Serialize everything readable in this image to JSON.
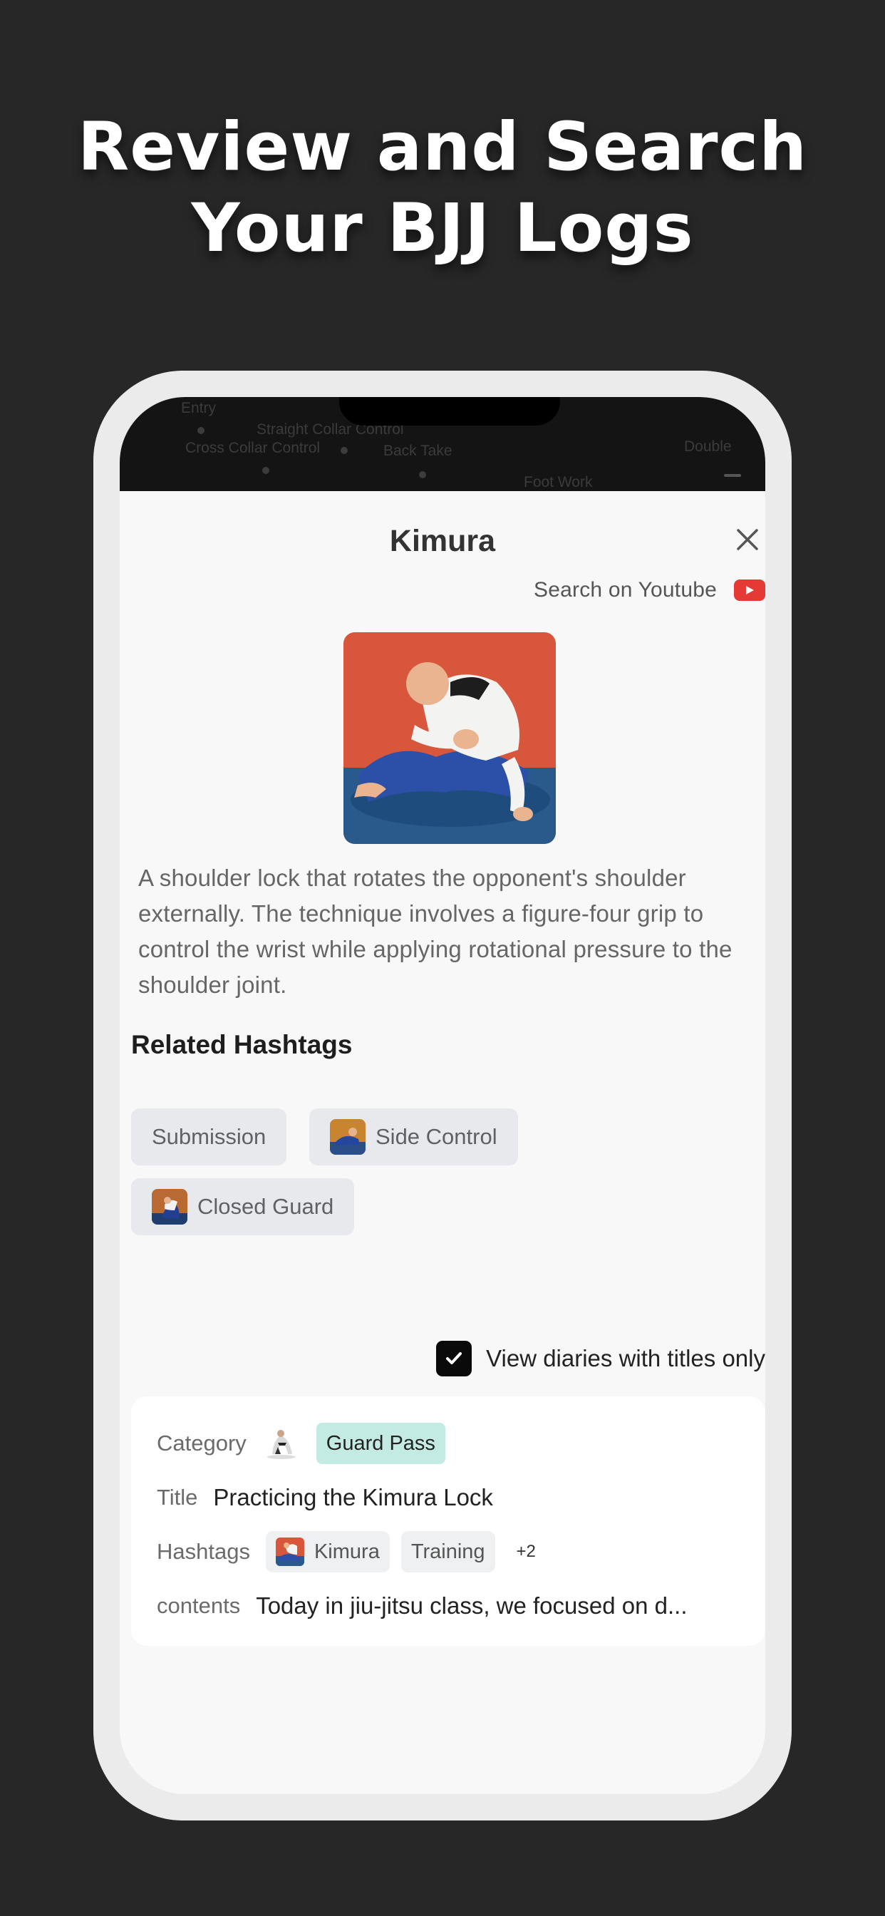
{
  "headline": {
    "line1": "Review and Search",
    "line2": "Your BJJ Logs"
  },
  "background_map": {
    "labels": [
      "Entry",
      "Straight Collar Control",
      "Cross Collar Control",
      "Back Take",
      "Foot Work",
      "Double"
    ]
  },
  "sheet": {
    "title": "Kimura",
    "close_icon": "close-icon",
    "youtube_label": "Search on Youtube",
    "youtube_icon": "youtube-icon",
    "image_alt": "Kimura technique illustration",
    "description": "A shoulder lock that rotates the opponent's shoulder externally. The technique involves a figure-four grip to control the wrist while applying rotational pressure to the shoulder joint.",
    "related_hashtags_title": "Related Hashtags",
    "related_hashtags": [
      {
        "label": "Submission",
        "has_thumb": false
      },
      {
        "label": "Side Control",
        "has_thumb": true
      },
      {
        "label": "Closed Guard",
        "has_thumb": true
      }
    ],
    "filter": {
      "checked": true,
      "label": "View diaries with titles only"
    }
  },
  "diary_card": {
    "category_label": "Category",
    "category_value": "Guard Pass",
    "title_label": "Title",
    "title_value": "Practicing the Kimura Lock",
    "hashtags_label": "Hashtags",
    "hashtags": [
      "Kimura",
      "Training"
    ],
    "more_count": "+2",
    "contents_label": "contents",
    "contents_value": "Today in jiu-jitsu class, we focused on d..."
  },
  "colors": {
    "background": "#272727",
    "frame": "#ebebeb",
    "sheet": "#f8f8f8",
    "chip": "#e8e9ec",
    "category_badge": "#c4ebe3",
    "youtube_red": "#e53935"
  }
}
